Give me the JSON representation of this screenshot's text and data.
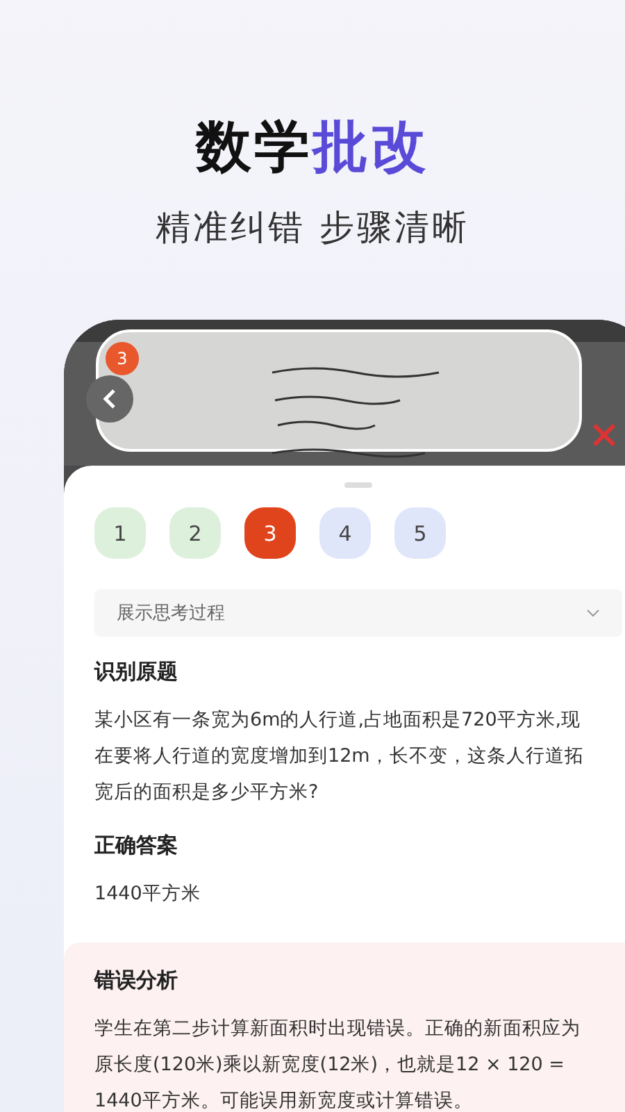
{
  "header": {
    "title": "数学**批改**",
    "subtitle": "精准纠错 步骤清晰"
  },
  "photo": {
    "kind": "picture",
    "badge": "3"
  },
  "steps": [
    {
      "label": "1",
      "color": "#dcf0dc",
      "selected": false
    },
    {
      "label": "2",
      "color": "#dcf0dc",
      "selected": false
    },
    {
      "label": "3",
      "color": "#e0441c",
      "selected": true
    },
    {
      "label": "4",
      "color": "#e0e6fa",
      "selected": false
    },
    {
      "label": "5",
      "color": "#e0e6fa",
      "selected": false
    }
  ],
  "thinking": {
    "label": "展示思考过程",
    "expanded": false
  },
  "sections": [
    {
      "kind": "plain",
      "title": "识别原题",
      "body": "某小区有一条宽为6m的人行道,占地面积是720平方米,现在要将人行道的宽度增加到12m，长不变，这条人行道拓宽后的面积是多少平方米?"
    },
    {
      "kind": "plain",
      "title": "正确答案",
      "body": "1440平方米"
    },
    {
      "kind": "error",
      "title": "错误分析",
      "body": "学生在第二步计算新面积时出现错误。正确的新面积应为原长度(120米)乘以新宽度(12米)，也就是12 × 120 = 1440平方米。可能误用新宽度或计算错误。"
    }
  ]
}
